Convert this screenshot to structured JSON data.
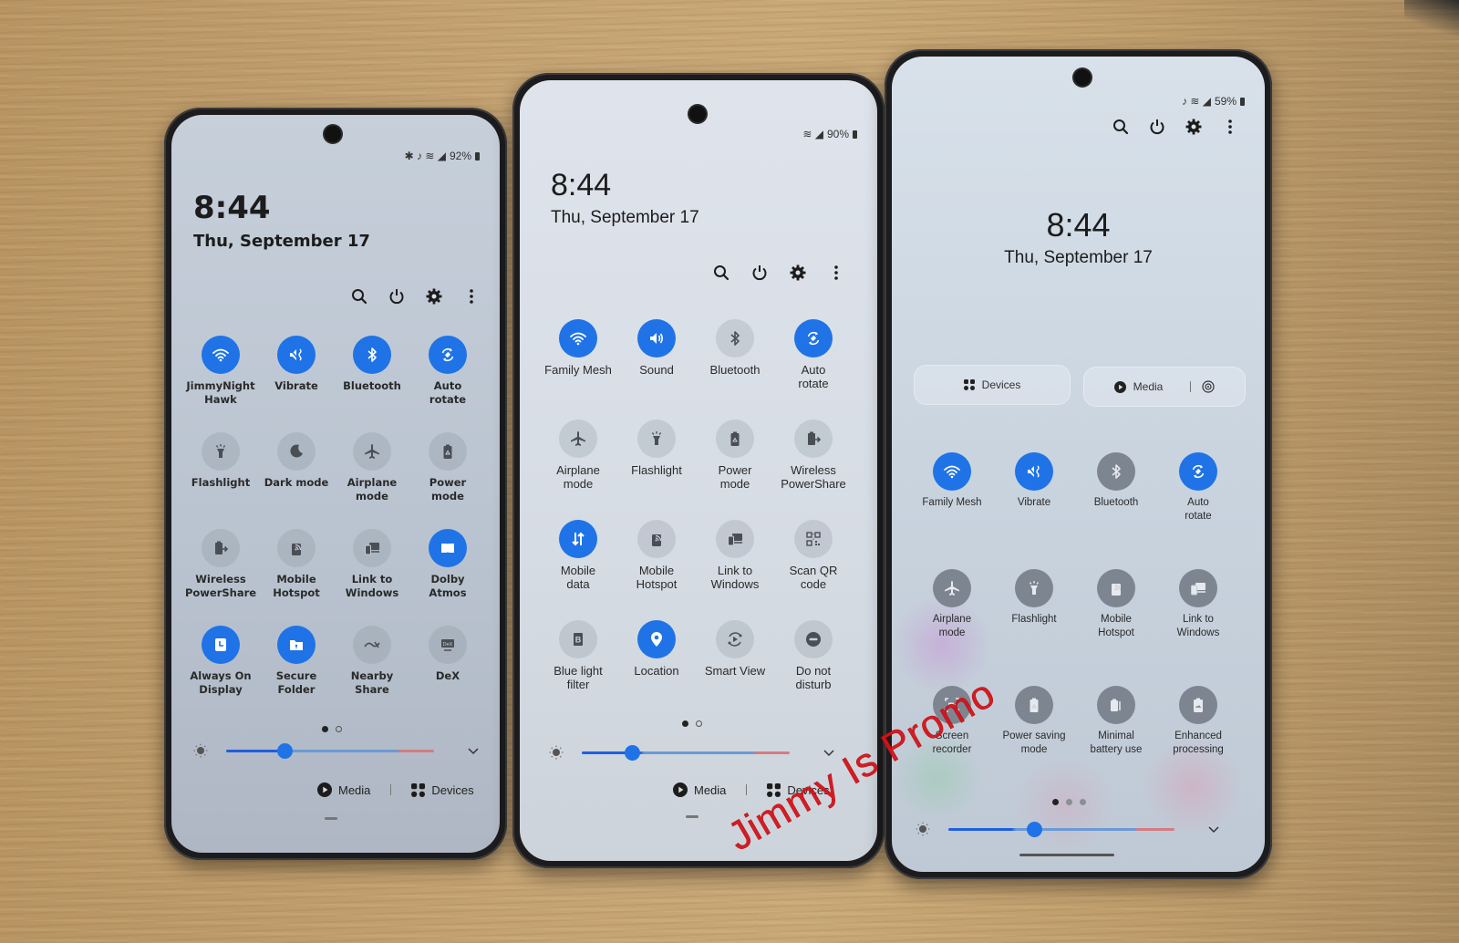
{
  "phones": [
    {
      "id": "left",
      "status": {
        "icons": [
          "bluetooth-icon",
          "mute-vibrate-icon",
          "wifi-icon",
          "signal-icon"
        ],
        "battery": "92%"
      },
      "time": "8:44",
      "date": "Thu, September 17",
      "tiles": [
        {
          "label": "JimmyNight\nHawk",
          "icon": "wifi",
          "on": true
        },
        {
          "label": "Vibrate",
          "icon": "vibrate",
          "on": true
        },
        {
          "label": "Bluetooth",
          "icon": "bluetooth",
          "on": true
        },
        {
          "label": "Auto\nrotate",
          "icon": "rotate",
          "on": true
        },
        {
          "label": "Flashlight",
          "icon": "flashlight",
          "on": false
        },
        {
          "label": "Dark mode",
          "icon": "moon",
          "on": false
        },
        {
          "label": "Airplane\nmode",
          "icon": "airplane",
          "on": false
        },
        {
          "label": "Power\nmode",
          "icon": "battery-recycle",
          "on": false
        },
        {
          "label": "Wireless\nPowerShare",
          "icon": "powershare",
          "on": false
        },
        {
          "label": "Mobile\nHotspot",
          "icon": "hotspot",
          "on": false
        },
        {
          "label": "Link to\nWindows",
          "icon": "link-windows",
          "on": false
        },
        {
          "label": "Dolby\nAtmos",
          "icon": "dolby",
          "on": true
        },
        {
          "label": "Always On\nDisplay",
          "icon": "clock",
          "on": true
        },
        {
          "label": "Secure\nFolder",
          "icon": "folder-lock",
          "on": true
        },
        {
          "label": "Nearby\nShare",
          "icon": "nearby",
          "on": false
        },
        {
          "label": "DeX",
          "icon": "dex",
          "on": false
        }
      ],
      "pages": {
        "count": 2,
        "active": 0
      },
      "brightness": 0.28,
      "bottom": {
        "media": "Media",
        "devices": "Devices"
      }
    },
    {
      "id": "middle",
      "status": {
        "icons": [
          "wifi-icon",
          "signal-icon"
        ],
        "battery": "90%"
      },
      "time": "8:44",
      "date": "Thu, September 17",
      "tiles": [
        {
          "label": "Family Mesh",
          "icon": "wifi",
          "on": true
        },
        {
          "label": "Sound",
          "icon": "sound",
          "on": true
        },
        {
          "label": "Bluetooth",
          "icon": "bluetooth",
          "on": false
        },
        {
          "label": "Auto\nrotate",
          "icon": "rotate",
          "on": true
        },
        {
          "label": "Airplane\nmode",
          "icon": "airplane",
          "on": false
        },
        {
          "label": "Flashlight",
          "icon": "flashlight",
          "on": false
        },
        {
          "label": "Power\nmode",
          "icon": "battery-recycle",
          "on": false
        },
        {
          "label": "Wireless\nPowerShare",
          "icon": "powershare",
          "on": false
        },
        {
          "label": "Mobile\ndata",
          "icon": "mobile-data",
          "on": true
        },
        {
          "label": "Mobile\nHotspot",
          "icon": "hotspot",
          "on": false
        },
        {
          "label": "Link to\nWindows",
          "icon": "link-windows",
          "on": false
        },
        {
          "label": "Scan QR\ncode",
          "icon": "qr",
          "on": false
        },
        {
          "label": "Blue light\nfilter",
          "icon": "bluelight",
          "on": false
        },
        {
          "label": "Location",
          "icon": "location",
          "on": true
        },
        {
          "label": "Smart View",
          "icon": "smart-view",
          "on": false
        },
        {
          "label": "Do not\ndisturb",
          "icon": "dnd",
          "on": false
        }
      ],
      "pages": {
        "count": 2,
        "active": 0
      },
      "brightness": 0.24,
      "bottom": {
        "media": "Media",
        "devices": "Devices"
      }
    },
    {
      "id": "right",
      "status": {
        "icons": [
          "mute-vibrate-icon",
          "wifi-icon",
          "signal-icon"
        ],
        "battery": "59%"
      },
      "time": "8:44",
      "date": "Thu, September 17",
      "top_buttons": {
        "devices": "Devices",
        "media": "Media"
      },
      "tiles": [
        {
          "label": "Family Mesh",
          "icon": "wifi",
          "on": true
        },
        {
          "label": "Vibrate",
          "icon": "vibrate",
          "on": true
        },
        {
          "label": "Bluetooth",
          "icon": "bluetooth",
          "on": false
        },
        {
          "label": "Auto\nrotate",
          "icon": "rotate",
          "on": true
        },
        {
          "label": "Airplane\nmode",
          "icon": "airplane",
          "on": false
        },
        {
          "label": "Flashlight",
          "icon": "flashlight",
          "on": false
        },
        {
          "label": "Mobile\nHotspot",
          "icon": "hotspot",
          "on": false
        },
        {
          "label": "Link to\nWindows",
          "icon": "link-windows",
          "on": false
        },
        {
          "label": "Screen\nrecorder",
          "icon": "screen-recorder",
          "on": false
        },
        {
          "label": "Power saving\nmode",
          "icon": "battery-recycle",
          "on": false
        },
        {
          "label": "Minimal\nbattery use",
          "icon": "minimal-battery",
          "on": false
        },
        {
          "label": "Enhanced\nprocessing",
          "icon": "enhanced",
          "on": false
        }
      ],
      "pages": {
        "count": 3,
        "active": 0
      },
      "brightness": 0.38
    }
  ],
  "watermark": "Jimmy Is Promo"
}
